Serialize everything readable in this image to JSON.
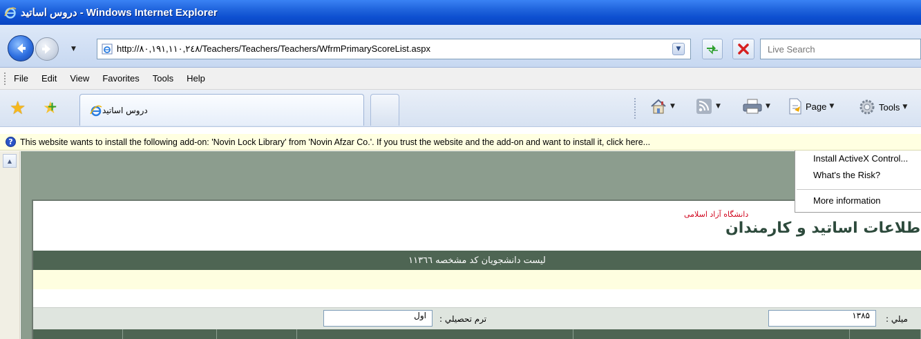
{
  "window": {
    "title": "دروس اساتيد - Windows Internet Explorer"
  },
  "navigation": {
    "url": "http://۸۰,۱۹۱,۱۱۰,۲٤۸/Teachers/Teachers/Teachers/WfrmPrimaryScoreList.aspx",
    "search_placeholder": "Live Search"
  },
  "menu": {
    "items": [
      "File",
      "Edit",
      "View",
      "Favorites",
      "Tools",
      "Help"
    ]
  },
  "tabs": {
    "active_label": "دروس اساتيد"
  },
  "toolbar": {
    "page_label": "Page",
    "tools_label": "Tools"
  },
  "infobar": {
    "text": "This website wants to install the following add-on: 'Novin Lock Library' from 'Novin Afzar Co.'. If you trust the website and the add-on and want to install it, click here..."
  },
  "infobar_menu": {
    "install": "Install ActiveX Control...",
    "risk": "What's the Risk?",
    "more": "More information"
  },
  "page": {
    "university_name": "دانشگاه آزاد اسلامی",
    "system_title": "طلاعات اساتيد و كارمندان",
    "list_header": "ليست دانشجويان كد مشخصه ۱۱۳٦٦",
    "term_label": "ترم تحصيلي :",
    "term_value": "اول",
    "year_label": "ميلي :",
    "year_value": "۱۳۸۵"
  },
  "colors": {
    "title_bar": "#1f63dc",
    "page_header": "#4e6553",
    "infobar_bg": "#ffffe1"
  }
}
